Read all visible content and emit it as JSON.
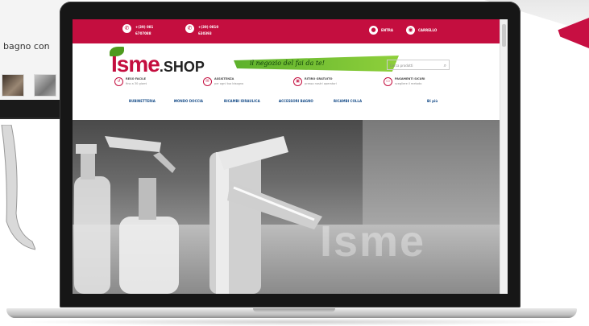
{
  "background_window": {
    "text": "bagno con"
  },
  "topbar": {
    "phone_1": "+(39) 081 6707088",
    "phone_1_line1": "+(39) 081",
    "phone_1_line2": "6707088",
    "phone_2": "+(39) 0810 630393",
    "phone_2_line1": "+(39) 0810",
    "phone_2_line2": "630393",
    "login_label": "ENTRA",
    "cart_label": "CARRELLO"
  },
  "header": {
    "logo_main": "Isme",
    "logo_suffix": ".SHOP",
    "slogan": "il negozio del fai da te!",
    "search_placeholder": "Cerca prodotti",
    "features": [
      {
        "title": "RESO FACILE",
        "subtitle": "fino a 30 giorni",
        "icon": "return-icon"
      },
      {
        "title": "ASSISTENZA",
        "subtitle": "per ogni tuo bisogno",
        "icon": "chat-icon"
      },
      {
        "title": "RITIRO GRATUITO",
        "subtitle": "presso nostri operatori",
        "icon": "pickup-icon"
      },
      {
        "title": "PAGAMENTI SICURI",
        "subtitle": "scegliere il metodo",
        "icon": "card-icon"
      }
    ]
  },
  "menu": {
    "items": [
      "RUBINETTERIA",
      "MONDO DOCCIA",
      "RICAMBI IDRAULICA",
      "ACCESSORI BAGNO",
      "RICAMBI COLLA",
      "Di più"
    ]
  },
  "hero": {
    "brand_watermark": "Isme"
  },
  "colors": {
    "brand": "#c40e3f",
    "slogan_green": "#5db12c",
    "menu_blue": "#1a4f8a"
  }
}
